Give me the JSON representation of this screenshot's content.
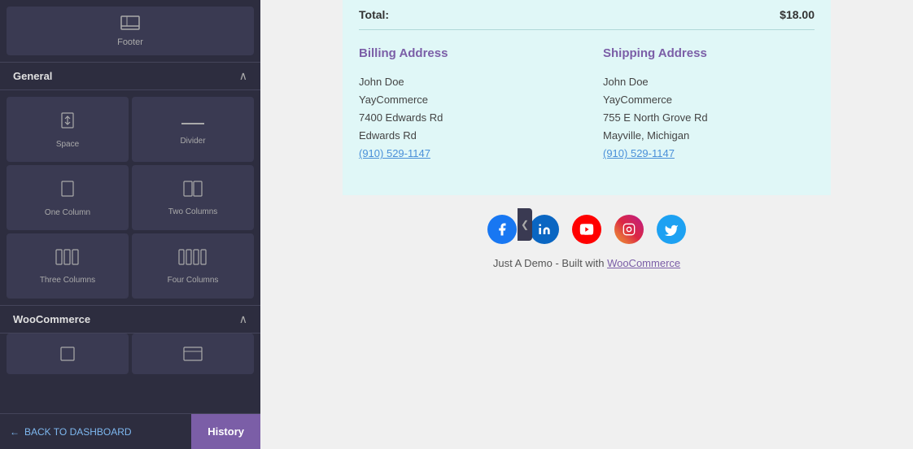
{
  "sidebar": {
    "footer_label": "Footer",
    "sections": {
      "general": {
        "title": "General",
        "blocks": [
          {
            "id": "space",
            "label": "Space",
            "icon": "↕"
          },
          {
            "id": "divider",
            "label": "Divider",
            "icon": "—"
          },
          {
            "id": "one-column",
            "label": "One Column",
            "icon": "▭"
          },
          {
            "id": "two-columns",
            "label": "Two Columns",
            "icon": "⬜⬜"
          },
          {
            "id": "three-columns",
            "label": "Three Columns",
            "icon": "|||"
          },
          {
            "id": "four-columns",
            "label": "Four Columns",
            "icon": "||||"
          }
        ]
      },
      "woocommerce": {
        "title": "WooCommerce"
      }
    },
    "back_label": "BACK TO DASHBOARD",
    "history_label": "History"
  },
  "main": {
    "total_label": "Total:",
    "total_amount": "$18.00",
    "billing": {
      "title": "Billing Address",
      "name": "John Doe",
      "company": "YayCommerce",
      "address1": "7400 Edwards Rd",
      "address2": "Edwards Rd",
      "phone": "(910) 529-1147"
    },
    "shipping": {
      "title": "Shipping Address",
      "name": "John Doe",
      "company": "YayCommerce",
      "address1": "755 E North Grove Rd",
      "address2": "Mayville, Michigan",
      "phone": "(910) 529-1147"
    },
    "social": {
      "icons": [
        "facebook",
        "linkedin",
        "youtube",
        "instagram",
        "twitter"
      ]
    },
    "footer_text": "Just A Demo - Built with",
    "footer_link": "WooCommerce"
  },
  "icons": {
    "collapse": "❮",
    "expand": "❯",
    "arrow_left": "←",
    "chevron_up": "^"
  }
}
